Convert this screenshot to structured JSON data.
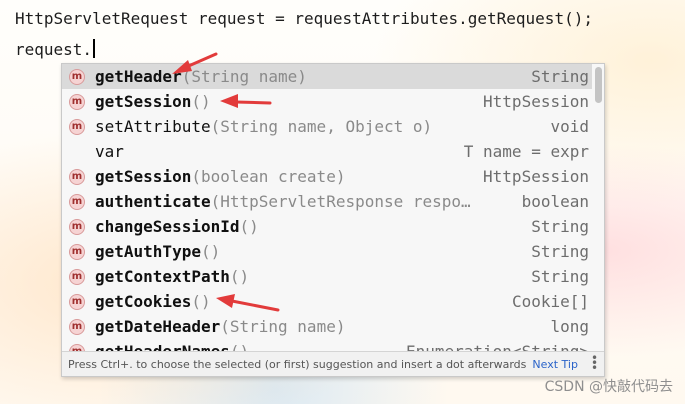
{
  "editor": {
    "line1": "HttpServletRequest request = requestAttributes.getRequest();",
    "line2": "request."
  },
  "completion": {
    "items": [
      {
        "icon": "m",
        "name": "getHeader",
        "params": "(String name)",
        "type": "String",
        "bold": true,
        "selected": true
      },
      {
        "icon": "m",
        "name": "getSession",
        "params": "()",
        "type": "HttpSession",
        "bold": true
      },
      {
        "icon": "m",
        "name": "setAttribute",
        "params": "(String name, Object o)",
        "type": "void",
        "bold": false
      },
      {
        "icon": "",
        "name": "var",
        "params": "",
        "type": "T name = expr",
        "bold": false
      },
      {
        "icon": "m",
        "name": "getSession",
        "params": "(boolean create)",
        "type": "HttpSession",
        "bold": true
      },
      {
        "icon": "m",
        "name": "authenticate",
        "params": "(HttpServletResponse respo…",
        "type": "boolean",
        "bold": true
      },
      {
        "icon": "m",
        "name": "changeSessionId",
        "params": "()",
        "type": "String",
        "bold": true
      },
      {
        "icon": "m",
        "name": "getAuthType",
        "params": "()",
        "type": "String",
        "bold": true
      },
      {
        "icon": "m",
        "name": "getContextPath",
        "params": "()",
        "type": "String",
        "bold": true
      },
      {
        "icon": "m",
        "name": "getCookies",
        "params": "()",
        "type": "Cookie[]",
        "bold": true
      },
      {
        "icon": "m",
        "name": "getDateHeader",
        "params": "(String name)",
        "type": "long",
        "bold": true
      },
      {
        "icon": "m",
        "name": "getHeaderNames",
        "params": "()",
        "type": "Enumeration<String>",
        "bold": true
      }
    ],
    "status_text": "Press Ctrl+. to choose the selected (or first) suggestion and insert a dot afterwards",
    "next_tip": "Next Tip",
    "more_icon": "more-vertical-icon"
  },
  "watermark": "CSDN @快敲代码去",
  "colors": {
    "arrow": "#e23b3b",
    "method_icon_bg": "#f6d3d3",
    "selected_row": "#dadada",
    "link": "#2a63c9"
  }
}
